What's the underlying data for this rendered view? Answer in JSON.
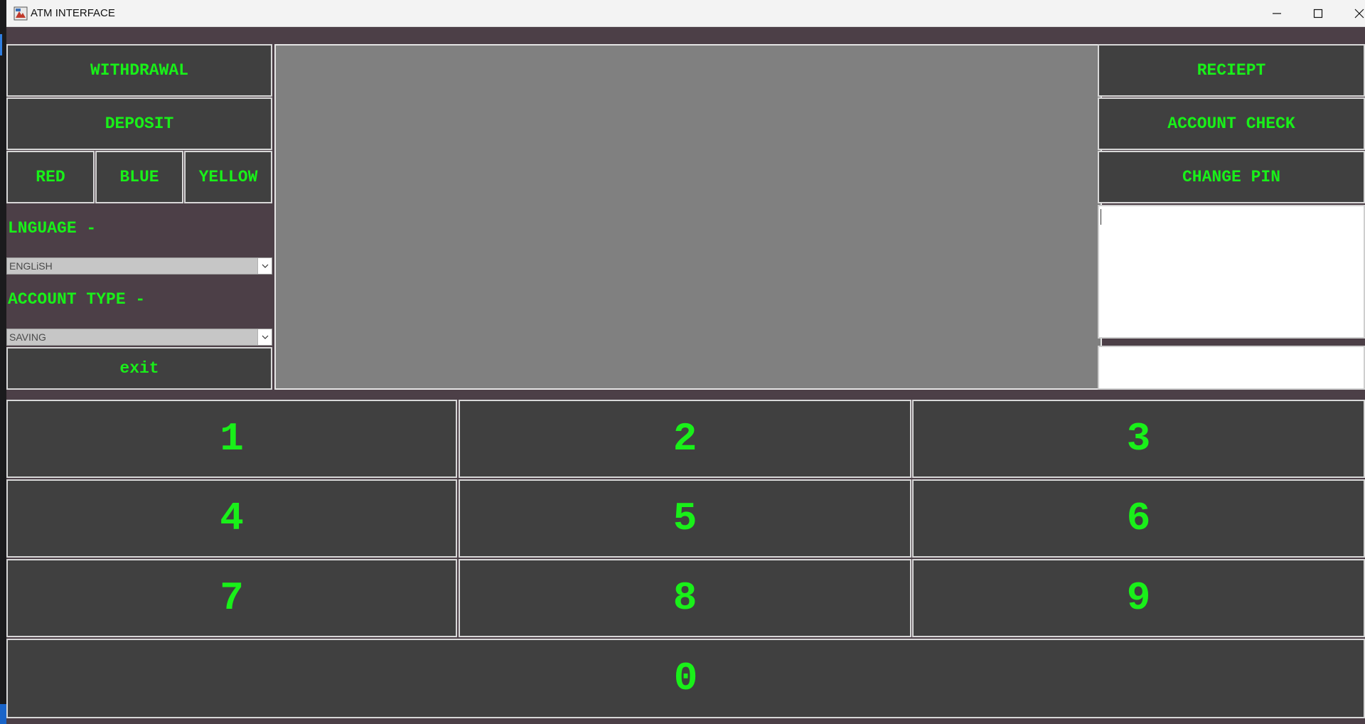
{
  "window": {
    "title": "ATM INTERFACE"
  },
  "left_panel": {
    "withdrawal": "WITHDRAWAL",
    "deposit": "DEPOSIT",
    "theme_red": "RED",
    "theme_blue": "BLUE",
    "theme_yellow": "YELLOW",
    "language_label": "LNGUAGE -",
    "language_value": "ENGLiSH",
    "account_type_label": "ACCOUNT TYPE -",
    "account_type_value": "SAVING",
    "exit": "exit"
  },
  "right_panel": {
    "receipt": "RECIEPT",
    "account_check": "ACCOUNT CHECK",
    "change_pin": "CHANGE PIN"
  },
  "keypad": {
    "keys": [
      "1",
      "2",
      "3",
      "4",
      "5",
      "6",
      "7",
      "8",
      "9",
      "0"
    ]
  },
  "colors": {
    "accent_text": "#19f019",
    "button_bg": "#404040",
    "window_bg": "#4c3f47",
    "screen_bg": "#808080"
  },
  "icons": [
    "app-icon",
    "minimize-icon",
    "maximize-icon",
    "close-icon",
    "chevron-down-icon"
  ]
}
